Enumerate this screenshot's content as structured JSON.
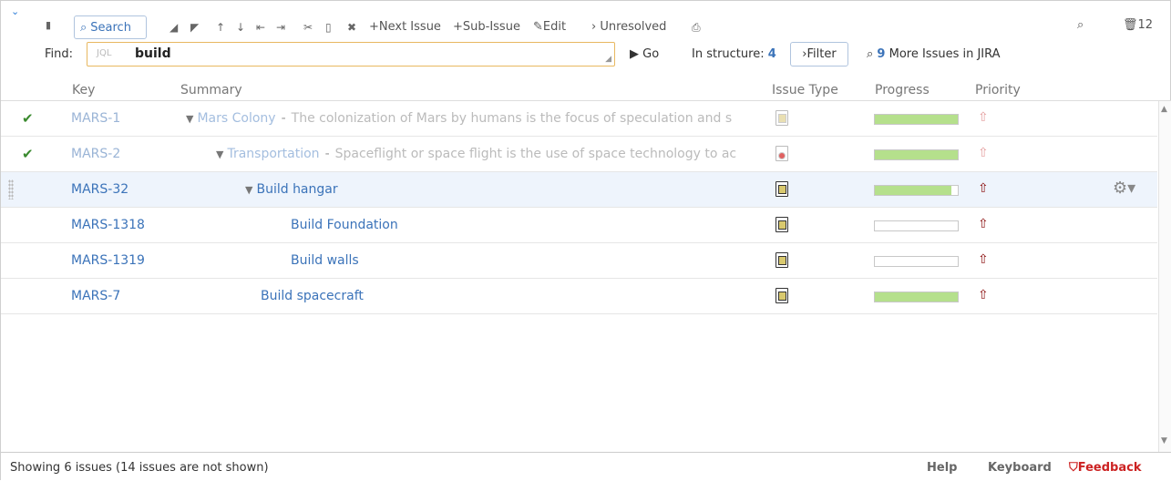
{
  "toolbar": {
    "search_label": "Search",
    "next_issue": "+Next Issue",
    "sub_issue": "+Sub-Issue",
    "edit": "Edit",
    "unresolved": "Unresolved",
    "right_count": "12",
    "icons": [
      "pin-icon",
      "search-icon",
      "move-up-left-icon",
      "move-down-right-icon",
      "arrow-up-icon",
      "arrow-down-icon",
      "outdent-icon",
      "indent-icon",
      "cut-icon",
      "paste-icon",
      "delete-icon",
      "edit-icon",
      "print-icon",
      "trash-icon"
    ]
  },
  "find": {
    "label": "Find:",
    "jql_tag": "JQL",
    "value": "build",
    "go": "Go",
    "in_structure_label": "In structure:",
    "in_structure_count": "4",
    "filter": "Filter",
    "more_count": "9",
    "more_label": "More Issues in JIRA"
  },
  "columns": {
    "key": "Key",
    "summary": "Summary",
    "issue_type": "Issue Type",
    "progress": "Progress",
    "priority": "Priority"
  },
  "rows": [
    {
      "key": "MARS-1",
      "title": "Mars Colony",
      "desc": "The colonization of Mars by humans is the focus of speculation and s",
      "resolved": true,
      "progress": 1.0
    },
    {
      "key": "MARS-2",
      "title": "Transportation",
      "desc": "Spaceflight or space flight is the use of space technology to ac",
      "resolved": true,
      "progress": 1.0
    },
    {
      "key": "MARS-32",
      "title": "Build hangar",
      "selected": true,
      "progress": 0.92
    },
    {
      "key": "MARS-1318",
      "title": "Build Foundation",
      "progress": 0
    },
    {
      "key": "MARS-1319",
      "title": "Build walls",
      "progress": 0
    },
    {
      "key": "MARS-7",
      "title": "Build spacecraft",
      "progress": 1.0
    }
  ],
  "footer": {
    "status": "Showing 6 issues (14 issues are not shown)",
    "help": "Help",
    "keyboard": "Keyboard",
    "feedback": "Feedback"
  },
  "colors": {
    "link": "#3b73b9",
    "progress_fill": "#b5e08c",
    "priority": "#8b0f0f",
    "feedback": "#cc2222",
    "selected_row": "#eef4fc"
  }
}
